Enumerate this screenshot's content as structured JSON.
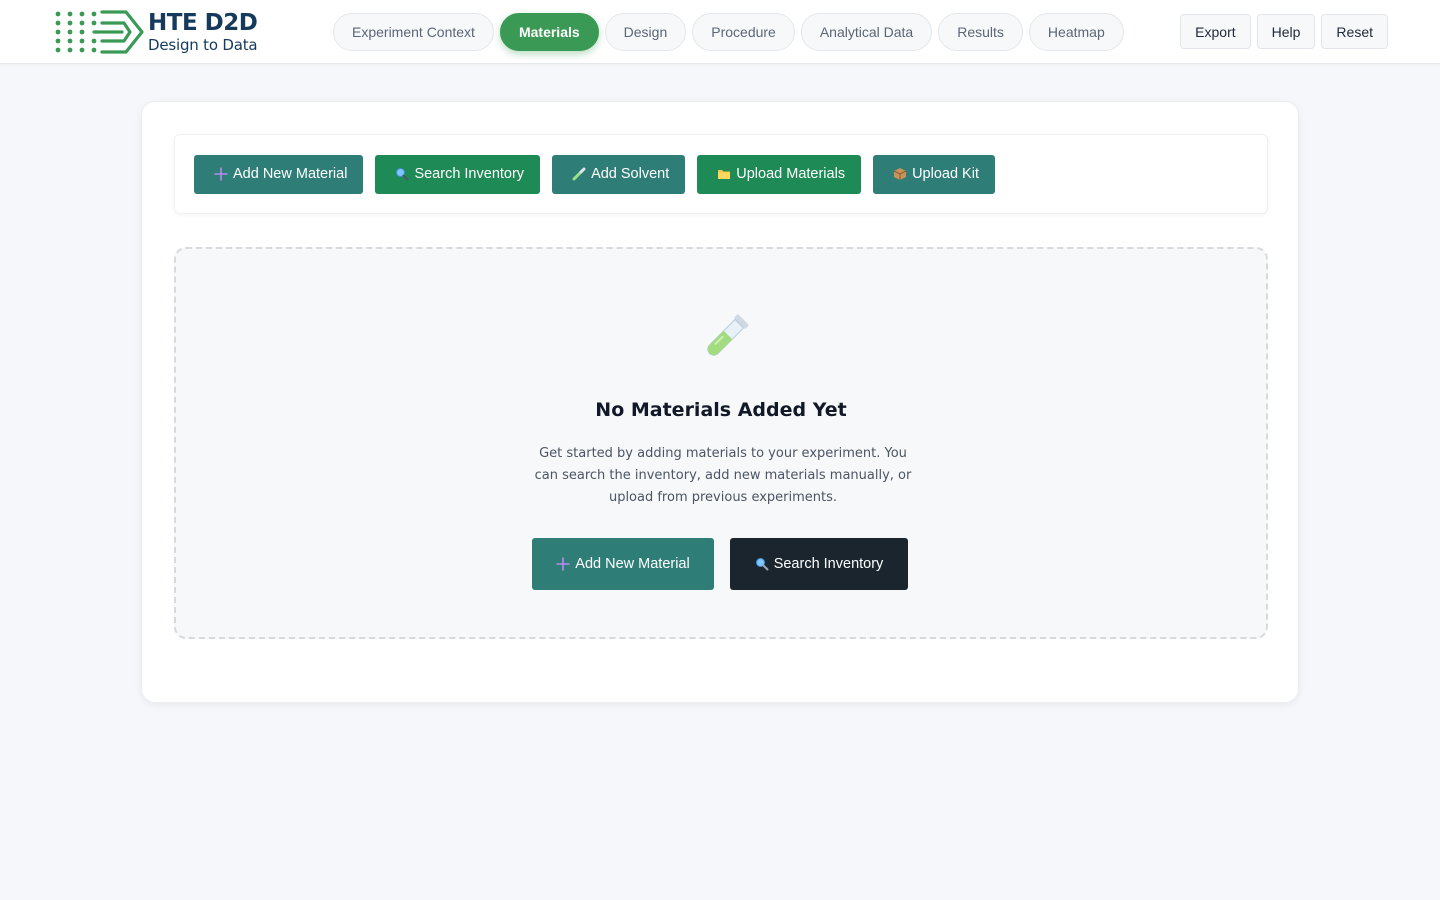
{
  "brand": {
    "title": "HTE D2D",
    "subtitle": "Design to Data",
    "color": "#163a5c",
    "accent": "#3a9a55"
  },
  "tabs": [
    {
      "label": "Experiment Context",
      "active": false
    },
    {
      "label": "Materials",
      "active": true
    },
    {
      "label": "Design",
      "active": false
    },
    {
      "label": "Procedure",
      "active": false
    },
    {
      "label": "Analytical Data",
      "active": false
    },
    {
      "label": "Results",
      "active": false
    },
    {
      "label": "Heatmap",
      "active": false
    }
  ],
  "header_actions": {
    "export": "Export",
    "help": "Help",
    "reset": "Reset"
  },
  "toolbar": {
    "add_new_material": {
      "label": "Add New Material",
      "icon": "plus-icon"
    },
    "search_inventory": {
      "label": "Search Inventory",
      "icon": "magnifier-icon"
    },
    "add_solvent": {
      "label": "Add Solvent",
      "icon": "pipette-icon"
    },
    "upload_materials": {
      "label": "Upload Materials",
      "icon": "folder-icon"
    },
    "upload_kit": {
      "label": "Upload Kit",
      "icon": "package-icon"
    }
  },
  "empty_state": {
    "icon": "test-tube-icon",
    "title": "No Materials Added Yet",
    "description": "Get started by adding materials to your experiment. You can search the inventory, add new materials manually, or upload from previous experiments.",
    "primary_label": "Add New Material",
    "secondary_label": "Search Inventory"
  },
  "colors": {
    "teal": "#2e7d77",
    "green": "#1e8a55",
    "dark": "#1b252e",
    "active_tab": "#3a9a55"
  }
}
